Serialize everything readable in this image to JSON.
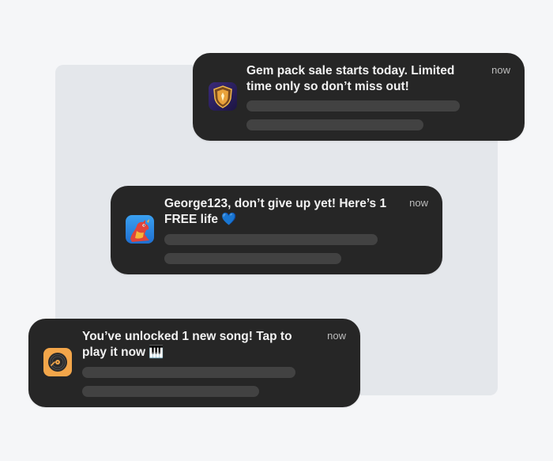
{
  "notifications": [
    {
      "app_icon": "shield-game-icon",
      "line1": "Gem pack sale starts today. Limited",
      "line2": "time only so don’t miss out!",
      "time": "now"
    },
    {
      "app_icon": "dragon-game-icon",
      "line1": "George123, don’t give up yet! Here’s 1",
      "line2": "FREE life 💙",
      "time": "now"
    },
    {
      "app_icon": "vinyl-record-icon",
      "line1": "You’ve unlocked 1 new song! Tap to",
      "line2": "play it now 🎹",
      "time": "now"
    }
  ],
  "colors": {
    "background": "#f5f6f8",
    "backdrop": "#e4e7eb",
    "card": "#262626",
    "placeholder_bar": "#424242",
    "title_text": "#f2f2f2",
    "time_text": "#bdbdbd"
  }
}
